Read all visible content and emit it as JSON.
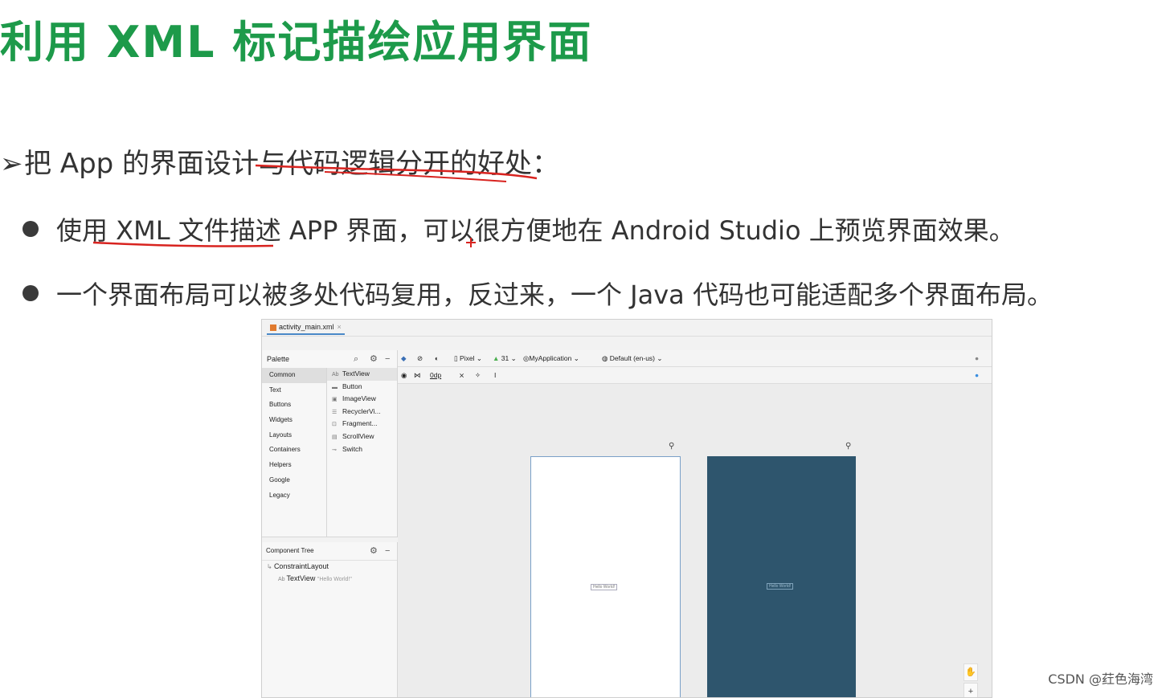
{
  "slide": {
    "title": "利用 XML 标记描绘应用界面",
    "main_point": "把 App 的界面设计与代码逻辑分开的好处：",
    "points": [
      "使用 XML 文件描述 APP 界面，可以很方便地在 Android Studio 上预览界面效果。",
      "一个界面布局可以被多处代码复用，反过来，一个 Java 代码也可能适配多个界面布局。"
    ]
  },
  "ide": {
    "file_tab": "activity_main.xml",
    "palette_label": "Palette",
    "categories": [
      "Common",
      "Text",
      "Buttons",
      "Widgets",
      "Layouts",
      "Containers",
      "Helpers",
      "Google",
      "Legacy"
    ],
    "components": [
      "TextView",
      "Button",
      "ImageView",
      "RecyclerVi...",
      "Fragment...",
      "ScrollView",
      "Switch"
    ],
    "component_tree_label": "Component Tree",
    "tree_root": "ConstraintLayout",
    "tree_child": "TextView",
    "tree_child_text": "\"Hello World!\"",
    "toolbar": {
      "device": "Pixel",
      "api": "31",
      "theme": "MyApplication",
      "locale": "Default (en-us)",
      "margin": "0dp"
    },
    "preview_text": "Hello World!"
  },
  "watermark": "CSDN @荭色海湾"
}
